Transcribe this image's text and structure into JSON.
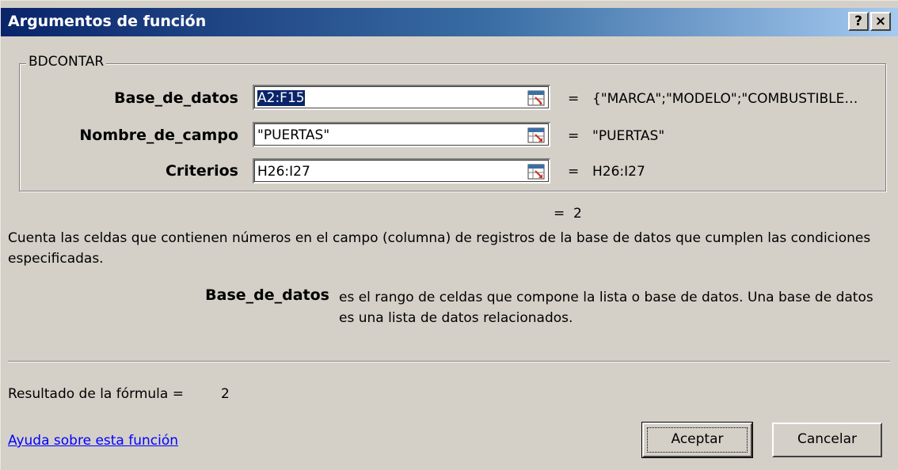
{
  "window": {
    "title": "Argumentos de función",
    "help_glyph": "?",
    "close_glyph": "×"
  },
  "function_group": {
    "name": "BDCONTAR",
    "args": [
      {
        "label": "Base_de_datos",
        "value": "A2:F15",
        "result": "{\"MARCA\";\"MODELO\";\"COMBUSTIBLE…",
        "icon": "range-selector-icon"
      },
      {
        "label": "Nombre_de_campo",
        "value": "\"PUERTAS\"",
        "result": "\"PUERTAS\"",
        "icon": "range-selector-icon"
      },
      {
        "label": "Criterios",
        "value": "H26:I27",
        "result": "H26:I27",
        "icon": "range-selector-icon"
      }
    ],
    "equals": "="
  },
  "function_result": {
    "equals": "=",
    "value": "2"
  },
  "description": "Cuenta las celdas que contienen números en el campo (columna) de registros de la base de datos que cumplen las condiciones especificadas.",
  "param_help": {
    "name": "Base_de_datos",
    "text": "es el rango de celdas que compone la lista o base de datos. Una base de datos es una lista de datos relacionados."
  },
  "formula_result": {
    "label": "Resultado de la fórmula =",
    "value": "2"
  },
  "help_link": "Ayuda sobre esta función",
  "buttons": {
    "ok": "Aceptar",
    "cancel": "Cancelar"
  },
  "colors": {
    "titlebar_start": "#0a246a",
    "titlebar_end": "#a6caf0",
    "face": "#d4d0c8",
    "link": "#0000ff"
  }
}
